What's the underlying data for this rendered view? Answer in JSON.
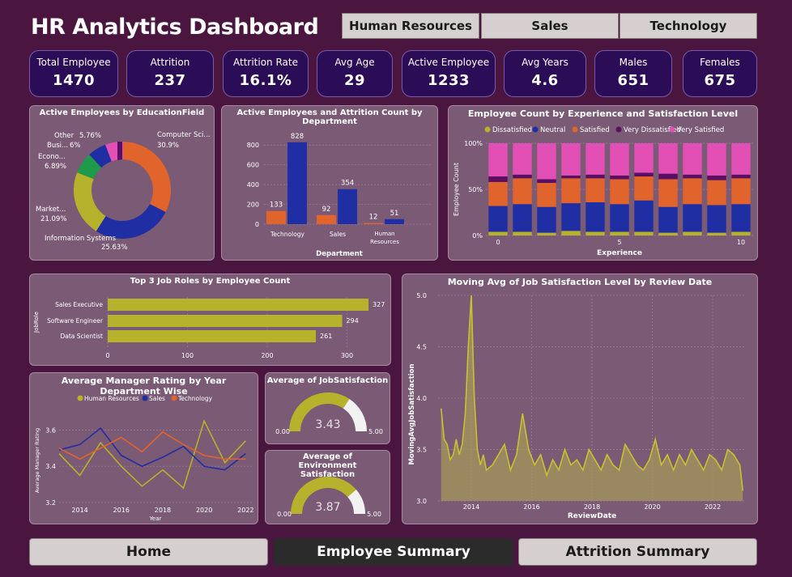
{
  "header": {
    "title": "HR Analytics Dashboard"
  },
  "departments": [
    "Human Resources",
    "Sales",
    "Technology"
  ],
  "kpis": [
    {
      "label": "Total Employee",
      "value": "1470"
    },
    {
      "label": "Attrition",
      "value": "237"
    },
    {
      "label": "Attrition Rate",
      "value": "16.1%"
    },
    {
      "label": "Avg Age",
      "value": "29"
    },
    {
      "label": "Active Employee",
      "value": "1233"
    },
    {
      "label": "Avg Years",
      "value": "4.6"
    },
    {
      "label": "Males",
      "value": "651"
    },
    {
      "label": "Females",
      "value": "675"
    }
  ],
  "colors": {
    "olive": "#b7b22b",
    "navy": "#1f2fa3",
    "orange": "#e0642b",
    "purple": "#5a0f63",
    "pink": "#e24fb5",
    "green": "#1f9a4a",
    "kpi_bg": "#2b0d57",
    "panel_bg": "#7a5a74"
  },
  "chart_data": [
    {
      "type": "pie",
      "title": "Active Employees by EducationField",
      "categories": [
        "Computer Sci...",
        "Information Systems",
        "Market...",
        "Econo...",
        "Busi...",
        "Other"
      ],
      "values": [
        30.9,
        25.63,
        21.09,
        6.89,
        6,
        5.76
      ],
      "value_labels": [
        "30.9%",
        "25.63%",
        "21.09%",
        "6.89%",
        "6%",
        "5.76%"
      ],
      "colors": [
        "#e0642b",
        "#1f2fa3",
        "#b7b22b",
        "#1f9a4a",
        "#1f2fa3",
        "#e24fb5",
        "#5a0f63"
      ]
    },
    {
      "type": "bar",
      "title": "Active Employees and Attrition Count by Department",
      "categories": [
        "Technology",
        "Sales",
        "Human Resources"
      ],
      "series": [
        {
          "values": [
            133,
            92,
            12
          ],
          "color": "#e0642b"
        },
        {
          "values": [
            828,
            354,
            51
          ],
          "color": "#1f2fa3"
        }
      ],
      "xlabel": "Department",
      "ylim": [
        0,
        900
      ],
      "yticks": [
        "0",
        "200",
        "400",
        "600",
        "800"
      ]
    },
    {
      "type": "bar",
      "title": "Employee Count by Experience and Satisfaction Level",
      "legend": [
        "Dissatisfied",
        "Neutral",
        "Satisfied",
        "Very Dissatisfied",
        "Very Satisfied"
      ],
      "legend_colors": [
        "#b7b22b",
        "#1f2fa3",
        "#e0642b",
        "#5a0f63",
        "#e24fb5"
      ],
      "xlabel": "Experience",
      "ylabel": "Employee Count",
      "yticks": [
        "0%",
        "50%",
        "100%"
      ],
      "xticks": [
        "0",
        "5",
        "10"
      ],
      "stacked_percent": [
        [
          4,
          28,
          26,
          6,
          36
        ],
        [
          4,
          30,
          28,
          4,
          34
        ],
        [
          3,
          28,
          26,
          4,
          39
        ],
        [
          5,
          30,
          27,
          3,
          35
        ],
        [
          4,
          32,
          26,
          4,
          34
        ],
        [
          4,
          30,
          27,
          4,
          35
        ],
        [
          4,
          34,
          26,
          4,
          32
        ],
        [
          3,
          28,
          30,
          6,
          33
        ],
        [
          4,
          30,
          28,
          4,
          34
        ],
        [
          3,
          30,
          27,
          5,
          35
        ],
        [
          4,
          30,
          28,
          4,
          34
        ]
      ]
    },
    {
      "type": "bar",
      "title": "Top 3 Job Roles by Employee Count",
      "categories": [
        "Sales Executive",
        "Software Engineer",
        "Data Scientist"
      ],
      "values": [
        327,
        294,
        261
      ],
      "ylabel": "JobRole",
      "xticks": [
        "0",
        "100",
        "200",
        "300"
      ],
      "xlim": [
        0,
        330
      ]
    },
    {
      "type": "line",
      "title": "Average Manager Rating by Year Department Wise",
      "xlabel": "Year",
      "ylabel": "Average Manager Rating",
      "x": [
        2013,
        2014,
        2015,
        2016,
        2017,
        2018,
        2019,
        2020,
        2021,
        2022
      ],
      "series": [
        {
          "name": "Human Resources",
          "color": "#b7b22b",
          "values": [
            3.47,
            3.35,
            3.53,
            3.4,
            3.29,
            3.38,
            3.28,
            3.65,
            3.42,
            3.54
          ]
        },
        {
          "name": "Sales",
          "color": "#1f2fa3",
          "values": [
            3.49,
            3.52,
            3.61,
            3.46,
            3.4,
            3.45,
            3.51,
            3.4,
            3.38,
            3.47
          ]
        },
        {
          "name": "Technology",
          "color": "#e0642b",
          "values": [
            3.5,
            3.44,
            3.5,
            3.56,
            3.48,
            3.59,
            3.52,
            3.46,
            3.44,
            3.44
          ]
        }
      ],
      "ylim": [
        3.2,
        3.7
      ],
      "yticks": [
        "3.2",
        "3.4",
        "3.6"
      ],
      "xticks": [
        "2014",
        "2016",
        "2018",
        "2020",
        "2022"
      ]
    },
    {
      "type": "gauge",
      "title": "Average of JobSatisfaction",
      "value": 3.43,
      "value_label": "3.43",
      "min": 0,
      "min_label": "0.00",
      "max": 5,
      "max_label": "5.00"
    },
    {
      "type": "gauge",
      "title": "Average of Environment Satisfaction",
      "value": 3.87,
      "value_label": "3.87",
      "min": 0,
      "min_label": "0.00",
      "max": 5,
      "max_label": "5.00"
    },
    {
      "type": "area",
      "title": "Moving Avg of Job Satisfaction Level by Review Date",
      "xlabel": "ReviewDate",
      "ylabel": "MovingAvgJobSatisfaction",
      "ylim": [
        3.0,
        5.0
      ],
      "yticks": [
        "3.0",
        "3.5",
        "4.0",
        "4.5",
        "5.0"
      ],
      "xticks": [
        "2014",
        "2016",
        "2018",
        "2020",
        "2022"
      ],
      "x": [
        2013.0,
        2013.1,
        2013.2,
        2013.3,
        2013.4,
        2013.5,
        2013.6,
        2013.7,
        2013.8,
        2013.9,
        2014.0,
        2014.1,
        2014.2,
        2014.3,
        2014.4,
        2014.5,
        2014.7,
        2014.9,
        2015.1,
        2015.3,
        2015.5,
        2015.7,
        2015.9,
        2016.1,
        2016.3,
        2016.5,
        2016.7,
        2016.9,
        2017.1,
        2017.3,
        2017.5,
        2017.7,
        2017.9,
        2018.1,
        2018.3,
        2018.5,
        2018.7,
        2018.9,
        2019.1,
        2019.3,
        2019.5,
        2019.7,
        2019.9,
        2020.1,
        2020.3,
        2020.5,
        2020.7,
        2020.9,
        2021.1,
        2021.3,
        2021.5,
        2021.7,
        2021.9,
        2022.1,
        2022.3,
        2022.5,
        2022.7,
        2022.9,
        2023.0
      ],
      "y": [
        3.9,
        3.6,
        3.55,
        3.4,
        3.45,
        3.6,
        3.45,
        3.55,
        3.85,
        4.5,
        5.0,
        4.0,
        3.5,
        3.35,
        3.45,
        3.3,
        3.35,
        3.45,
        3.55,
        3.3,
        3.45,
        3.85,
        3.5,
        3.35,
        3.45,
        3.25,
        3.4,
        3.3,
        3.5,
        3.35,
        3.4,
        3.3,
        3.5,
        3.4,
        3.3,
        3.45,
        3.35,
        3.3,
        3.55,
        3.45,
        3.35,
        3.3,
        3.4,
        3.6,
        3.35,
        3.45,
        3.3,
        3.45,
        3.35,
        3.5,
        3.4,
        3.3,
        3.45,
        3.4,
        3.3,
        3.5,
        3.45,
        3.35,
        3.1
      ]
    }
  ],
  "footer_nav": [
    "Home",
    "Employee Summary",
    "Attrition Summary"
  ]
}
